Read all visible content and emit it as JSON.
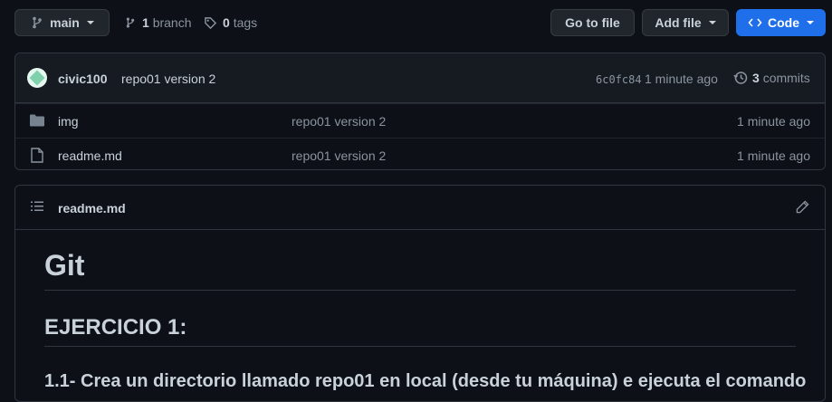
{
  "toolbar": {
    "branch_button": "main",
    "branches_count": "1",
    "branches_label": "branch",
    "tags_count": "0",
    "tags_label": "tags",
    "go_to_file": "Go to file",
    "add_file": "Add file",
    "code": "Code"
  },
  "latest_commit": {
    "author": "civic100",
    "message": "repo01 version 2",
    "sha": "6c0fc84",
    "time": "1 minute ago",
    "commits_count": "3",
    "commits_label": "commits"
  },
  "files": [
    {
      "name": "img",
      "type": "folder",
      "message": "repo01 version 2",
      "time": "1 minute ago"
    },
    {
      "name": "readme.md",
      "type": "file",
      "message": "repo01 version 2",
      "time": "1 minute ago"
    }
  ],
  "readme": {
    "filename": "readme.md",
    "h1": "Git",
    "h2": "EJERCICIO 1:",
    "h3": "1.1- Crea un directorio llamado repo01 en local (desde tu máquina) e ejecuta el comando"
  },
  "colors": {
    "background": "#0d1117",
    "primary_button": "#1f6feb",
    "border": "#30363d"
  }
}
